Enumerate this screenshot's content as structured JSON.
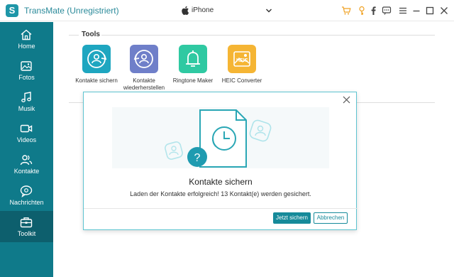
{
  "app": {
    "title": "TransMate (Unregistriert)",
    "logo_letter": "S"
  },
  "device": {
    "name": "iPhone"
  },
  "toolbar_icons": [
    "cart-icon",
    "key-icon",
    "facebook-icon",
    "feedback-icon",
    "menu-icon",
    "minimize-icon",
    "maximize-icon",
    "close-icon"
  ],
  "sidebar": {
    "items": [
      {
        "label": "Home",
        "icon": "home-icon"
      },
      {
        "label": "Fotos",
        "icon": "photo-icon"
      },
      {
        "label": "Musik",
        "icon": "music-icon"
      },
      {
        "label": "Videos",
        "icon": "video-icon"
      },
      {
        "label": "Kontakte",
        "icon": "contacts-icon"
      },
      {
        "label": "Nachrichten",
        "icon": "messages-icon"
      },
      {
        "label": "Toolkit",
        "icon": "toolkit-icon"
      }
    ],
    "active": "Toolkit"
  },
  "main": {
    "tools_heading": "Tools",
    "tools": [
      {
        "label": "Kontakte sichern",
        "icon": "backup-contacts-icon",
        "color": "#1ea6c0"
      },
      {
        "label": "Kontakte wiederherstellen",
        "icon": "restore-contacts-icon",
        "color": "#6f7fc9"
      },
      {
        "label": "Ringtone Maker",
        "icon": "bell-icon",
        "color": "#2fc9a2"
      },
      {
        "label": "HEIC Converter",
        "icon": "heic-icon",
        "color": "#f5b534"
      }
    ]
  },
  "modal": {
    "title": "Kontakte sichern",
    "message": "Laden der Kontakte erfolgreich! 13 Kontakt(e) werden gesichert.",
    "primary_button": "Jetzt sichern",
    "secondary_button": "Abbrechen",
    "question_mark": "?"
  },
  "colors": {
    "accent": "#168a9a",
    "sidebar": "#0f7a8a",
    "sidebar_active": "#0d5f6d"
  }
}
